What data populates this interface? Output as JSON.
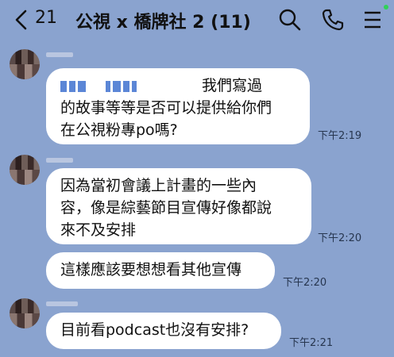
{
  "header": {
    "unread_count": "21",
    "chat_title": "公視 x 橋牌社 2 (11)"
  },
  "colors": {
    "background": "#8aa3cf",
    "bubble": "#ffffff",
    "online_dot": "#2fd159"
  },
  "messages": [
    {
      "lines": [
        "我們寫過",
        "的故事等等是否可以提供給你們",
        "在公視粉專po嗎?"
      ],
      "time": "下午2:19"
    },
    {
      "lines": [
        "因為當初會議上計畫的一些內",
        "容，像是綜藝節目宣傳好像都說",
        "來不及安排"
      ],
      "time": "下午2:20"
    },
    {
      "lines": [
        "這樣應該要想想看其他宣傳"
      ],
      "time": "下午2:20"
    },
    {
      "lines": [
        "目前看podcast也沒有安排?"
      ],
      "time": "下午2:21"
    }
  ]
}
